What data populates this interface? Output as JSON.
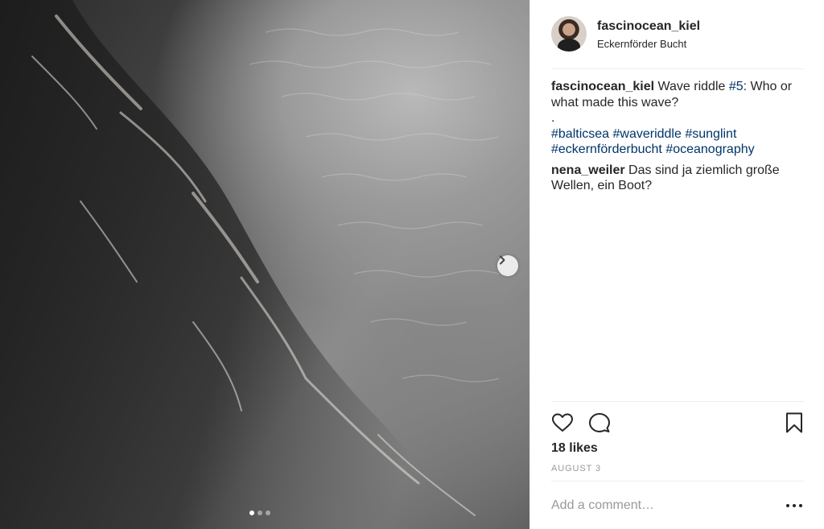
{
  "post": {
    "username": "fascinocean_kiel",
    "location": "Eckernförder Bucht",
    "likes_text": "18 likes",
    "date": "AUGUST 3",
    "add_comment_placeholder": "Add a comment…"
  },
  "caption": {
    "username": "fascinocean_kiel",
    "text_before": " Wave riddle ",
    "hashtag_number": "#5",
    "text_after": ": Who or what made this wave?",
    "line_dot": ".",
    "hashtags": [
      "#balticsea",
      "#waveriddle",
      "#sunglint",
      "#eckernförderbucht",
      "#oceanography"
    ]
  },
  "comments": [
    {
      "username": "nena_weiler",
      "text": " Das sind ja ziemlich große Wellen, ein Boot?"
    }
  ],
  "carousel": {
    "total_slides": 3,
    "active_index": 0
  },
  "icons": {
    "like": "heart-icon",
    "comment": "speech-bubble-icon",
    "save": "bookmark-icon",
    "next": "chevron-right-icon",
    "more": "more-options-icon"
  },
  "colors": {
    "hashtag": "#003569",
    "muted": "#999999",
    "text": "#262626"
  }
}
